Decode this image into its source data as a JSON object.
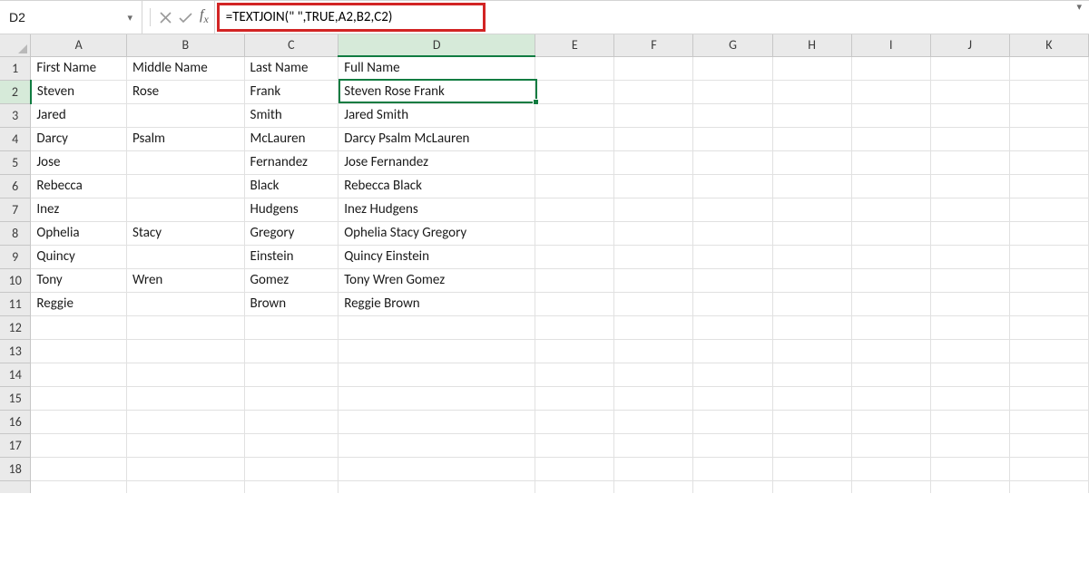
{
  "namebox": {
    "value": "D2"
  },
  "formula": {
    "value": "=TEXTJOIN(\" \",TRUE,A2,B2,C2)"
  },
  "columns": [
    "A",
    "B",
    "C",
    "D",
    "E",
    "F",
    "G",
    "H",
    "I",
    "J",
    "K"
  ],
  "selected_col": "D",
  "selected_row": 2,
  "row_count": 19,
  "headers": {
    "a": "First Name",
    "b": "Middle Name",
    "c": "Last Name",
    "d": "Full Name"
  },
  "rows": [
    {
      "a": "Steven",
      "b": "Rose",
      "c": "Frank",
      "d": "Steven Rose Frank"
    },
    {
      "a": "Jared",
      "b": "",
      "c": "Smith",
      "d": "Jared Smith"
    },
    {
      "a": "Darcy",
      "b": "Psalm",
      "c": "McLauren",
      "d": "Darcy Psalm McLauren"
    },
    {
      "a": "Jose",
      "b": "",
      "c": "Fernandez",
      "d": "Jose Fernandez"
    },
    {
      "a": "Rebecca",
      "b": "",
      "c": "Black",
      "d": "Rebecca Black"
    },
    {
      "a": "Inez",
      "b": "",
      "c": "Hudgens",
      "d": "Inez Hudgens"
    },
    {
      "a": "Ophelia",
      "b": "Stacy",
      "c": "Gregory",
      "d": "Ophelia Stacy Gregory"
    },
    {
      "a": "Quincy",
      "b": "",
      "c": "Einstein",
      "d": "Quincy Einstein"
    },
    {
      "a": "Tony",
      "b": "Wren",
      "c": "Gomez",
      "d": "Tony Wren Gomez"
    },
    {
      "a": "Reggie",
      "b": "",
      "c": "Brown",
      "d": "Reggie Brown"
    }
  ]
}
